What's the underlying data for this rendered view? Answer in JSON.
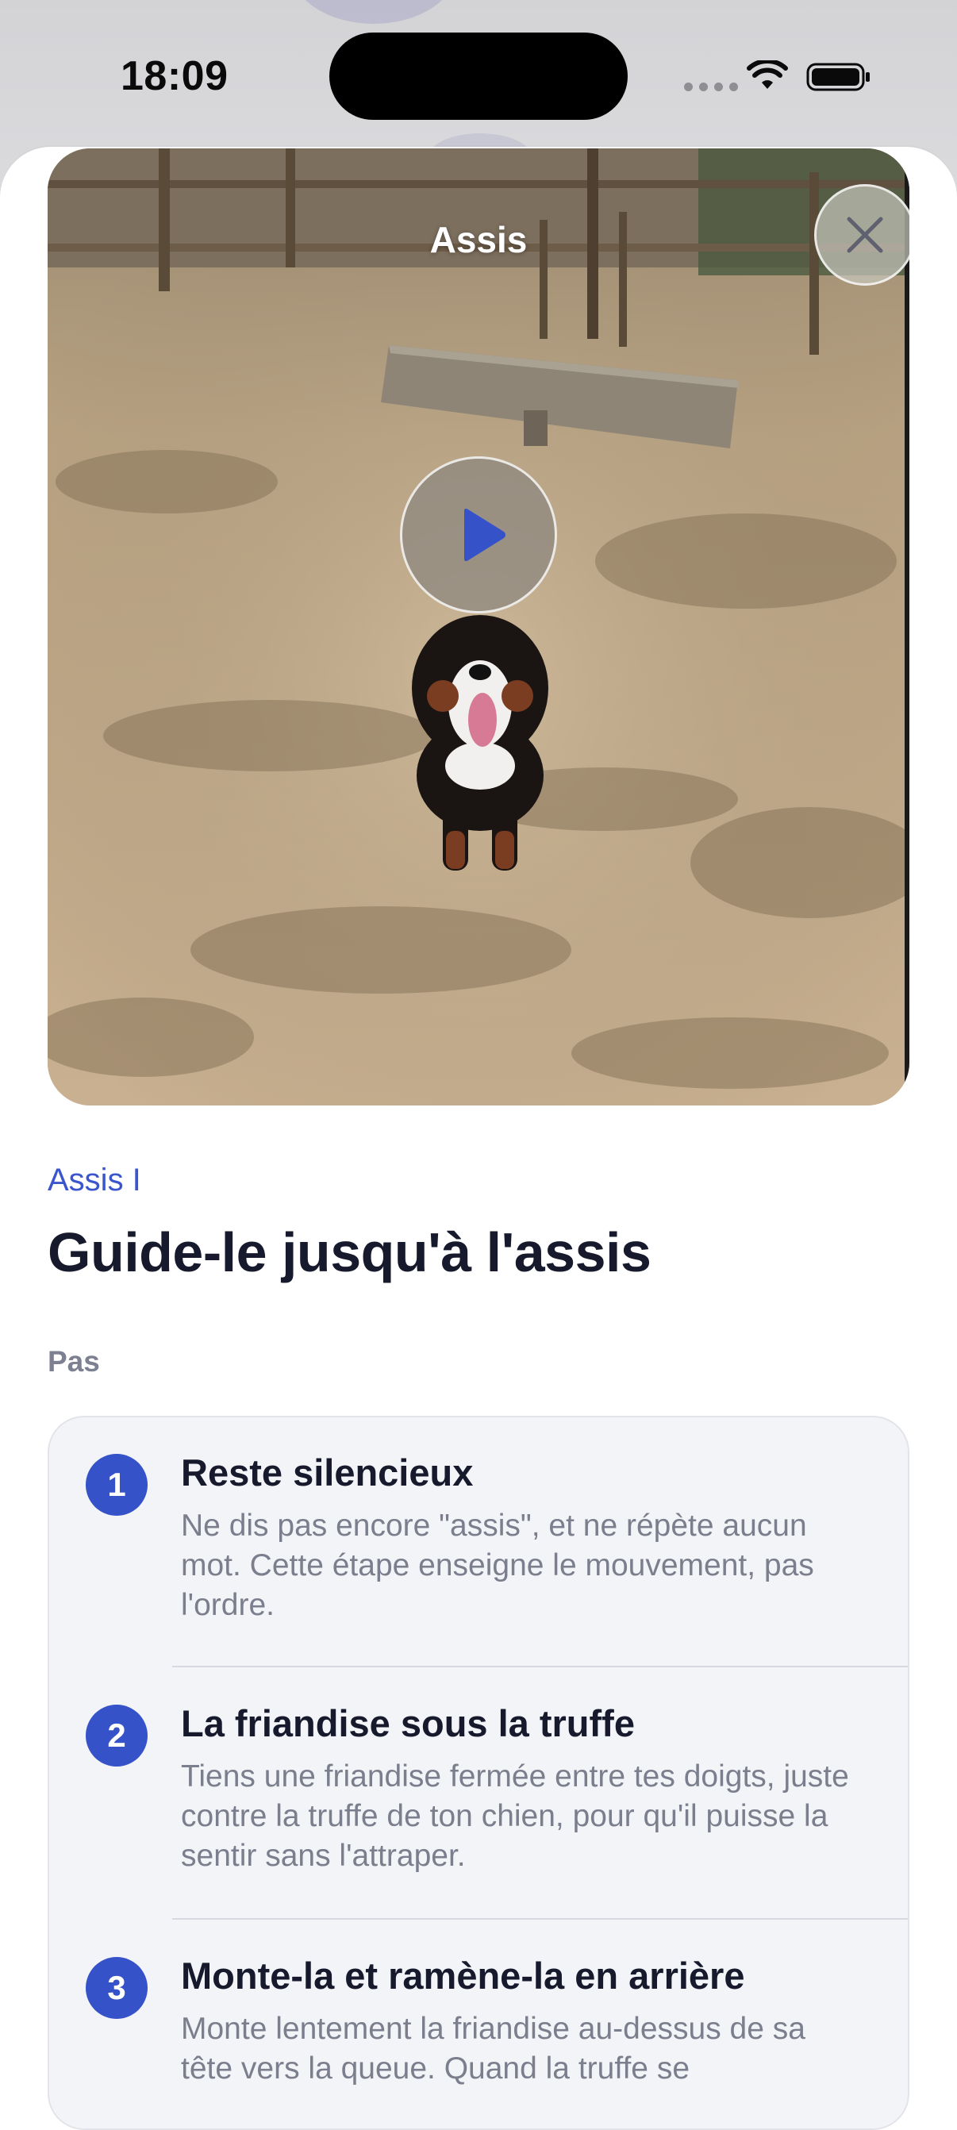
{
  "status_bar": {
    "time": "18:09"
  },
  "video": {
    "title": "Assis"
  },
  "lesson": {
    "eyebrow": "Assis I",
    "title": "Guide-le jusqu'à l'assis",
    "section_label": "Pas"
  },
  "steps": [
    {
      "number": "1",
      "title": "Reste silencieux",
      "description": "Ne dis pas encore \"assis\", et ne répète aucun mot. Cette étape enseigne le mouvement, pas l'ordre."
    },
    {
      "number": "2",
      "title": "La friandise sous la truffe",
      "description": "Tiens une friandise fermée entre tes doigts, juste contre la truffe de ton chien, pour qu'il puisse la sentir sans l'attraper."
    },
    {
      "number": "3",
      "title": "Monte-la et ramène-la en arrière",
      "description": "Monte lentement la friandise au-dessus de sa tête vers la queue. Quand la truffe se"
    }
  ],
  "colors": {
    "accent": "#3552c8",
    "eyebrow": "#3b55cc",
    "title": "#161a2c",
    "muted": "#7b7e8c",
    "card_bg": "#f3f4f8"
  },
  "icons": {
    "close": "close-icon",
    "play": "play-icon",
    "wifi": "wifi-icon",
    "battery": "battery-icon",
    "signal": "cellular-signal-icon"
  }
}
